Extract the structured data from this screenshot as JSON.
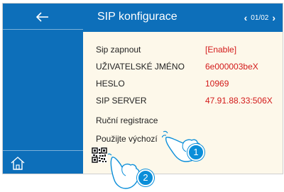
{
  "header": {
    "title": "SIP konfigurace",
    "page_indicator": "01/02",
    "prev_icon": "chevron-left-icon",
    "next_icon": "chevron-right-icon"
  },
  "sidebar": {
    "back_icon": "arrow-left-icon",
    "home_icon": "home-icon"
  },
  "settings": [
    {
      "label": "Sip zapnout",
      "value": "[Enable]"
    },
    {
      "label": "UŽIVATELSKÉ JMÉNO",
      "value": "6e000003beX"
    },
    {
      "label": "HESLO",
      "value": "10969"
    },
    {
      "label": "SIP SERVER",
      "value": "47.91.88.33:506X"
    }
  ],
  "actions": [
    {
      "label": "Ruční registrace"
    },
    {
      "label": "Použijte výchozí"
    }
  ],
  "qr_icon": "qr-code-icon",
  "callouts": [
    {
      "number": "1"
    },
    {
      "number": "2"
    }
  ],
  "colors": {
    "brand_blue": "#0d6fba",
    "value_red": "#d31a1a",
    "panel_bg": "#fdf8ea",
    "badge_blue": "#0a8ed9"
  }
}
